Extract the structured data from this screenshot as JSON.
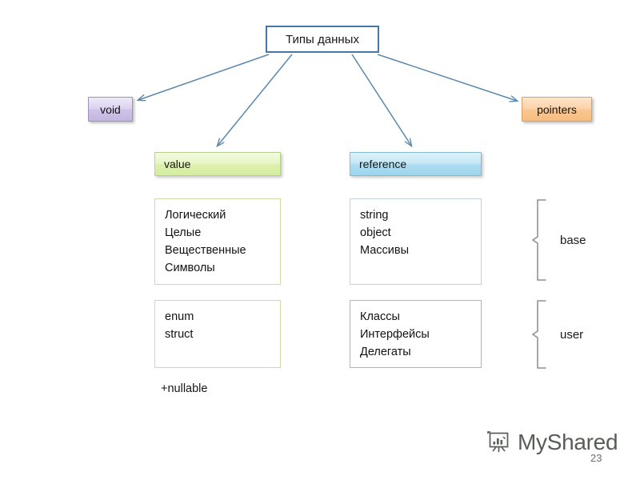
{
  "diagram": {
    "root": {
      "label": "Типы данных"
    },
    "void": {
      "label": "void"
    },
    "pointers": {
      "label": "pointers"
    },
    "value": {
      "header": "value",
      "base_types": [
        "Логический",
        "Целые",
        "Вещественные",
        "Символы"
      ],
      "user_types": [
        "enum",
        "struct"
      ],
      "note": "+nullable"
    },
    "reference": {
      "header": "reference",
      "base_types": [
        "string",
        "object",
        "Массивы"
      ],
      "user_types": [
        "Классы",
        "Интерфейсы",
        "Делегаты"
      ]
    },
    "group_labels": {
      "base": "base",
      "user": "user"
    },
    "colors": {
      "root_border": "#4675a8",
      "arrow": "#5b88ad",
      "void_fill": "#cfc1e6",
      "pointers_fill": "#f9c791",
      "value_fill": "#dcf0ad",
      "reference_fill": "#abdcf1",
      "brace": "#8a9298"
    }
  },
  "watermark": {
    "brand": "MyShared",
    "icon": "presentation-board-chart-icon"
  },
  "footer": {
    "page_number": "23"
  }
}
